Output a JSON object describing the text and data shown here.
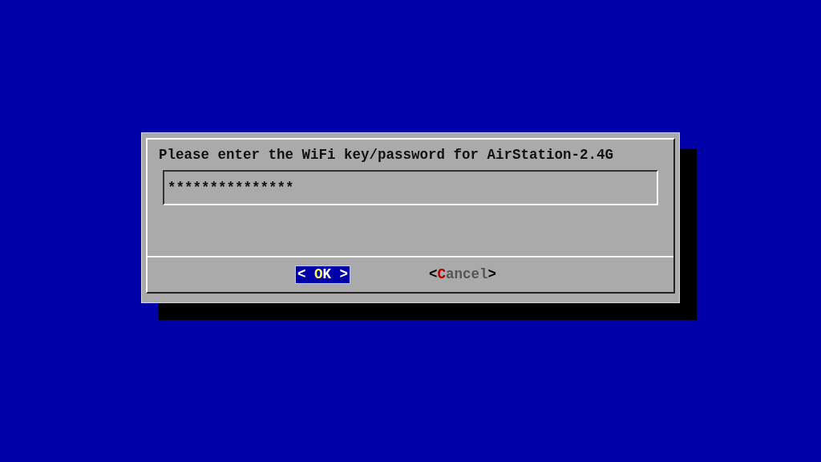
{
  "dialog": {
    "prompt": "Please enter the WiFi key/password for AirStation-2.4G",
    "password_field": {
      "value": "***************"
    },
    "buttons": [
      {
        "left": "<",
        "label": "OK",
        "right": ">",
        "selected": true
      },
      {
        "left": "<",
        "label": "Cancel",
        "right": ">",
        "selected": false
      }
    ]
  }
}
